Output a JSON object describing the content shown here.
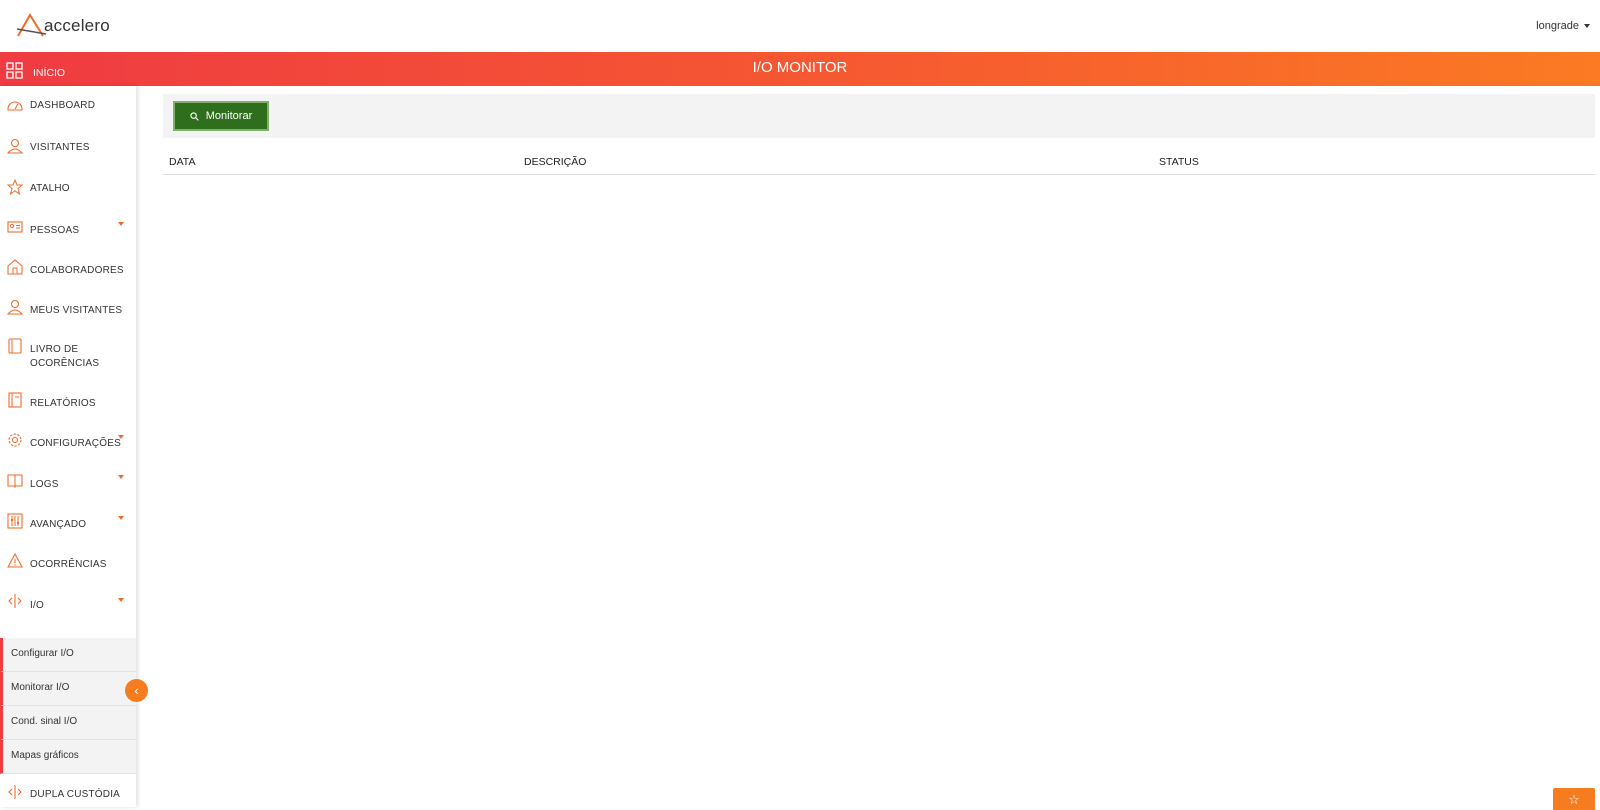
{
  "app": {
    "brand": "accelero",
    "user": "longrade",
    "accent_color": "#f26b2a",
    "primary_button_color": "#2e6e1c"
  },
  "titlebar": {
    "home_label": "INÍCIO",
    "page_title": "I/O MONITOR"
  },
  "sidebar": {
    "items": [
      {
        "label": "DASHBOARD",
        "icon": "dashboard-icon"
      },
      {
        "label": "VISITANTES",
        "icon": "user-icon"
      },
      {
        "label": "ATALHO",
        "icon": "star-icon"
      },
      {
        "label": "PESSOAS",
        "icon": "id-card-icon"
      },
      {
        "label": "COLABORADORES",
        "icon": "building-icon"
      },
      {
        "label": "MEUS VISITANTES",
        "icon": "user-icon"
      },
      {
        "label": "LIVRO DE OCORÊNCIAS",
        "icon": "book-icon"
      },
      {
        "label": "RELATÓRIOS",
        "icon": "report-icon"
      },
      {
        "label": "CONFIGURAÇÕES",
        "icon": "gear-icon"
      },
      {
        "label": "LOGS",
        "icon": "open-book-icon"
      },
      {
        "label": "AVANÇADO",
        "icon": "sliders-icon"
      },
      {
        "label": "OCORRÊNCIAS",
        "icon": "warning-icon"
      },
      {
        "label": "I/O",
        "icon": "io-arrows-icon"
      },
      {
        "label": "DUPLA CUSTÓDIA",
        "icon": "io-arrows-icon"
      }
    ],
    "io_submenu": [
      {
        "label": "Configurar I/O"
      },
      {
        "label": "Monitorar I/O"
      },
      {
        "label": "Cond. sinal I/O"
      },
      {
        "label": "Mapas gráficos"
      }
    ],
    "collapse_glyph": "‹"
  },
  "toolbar": {
    "monitor_label": "Monitorar"
  },
  "table": {
    "columns": [
      "DATA",
      "DESCRIÇÃO",
      "STATUS"
    ],
    "rows": []
  },
  "fab": {
    "glyph": "☆"
  }
}
